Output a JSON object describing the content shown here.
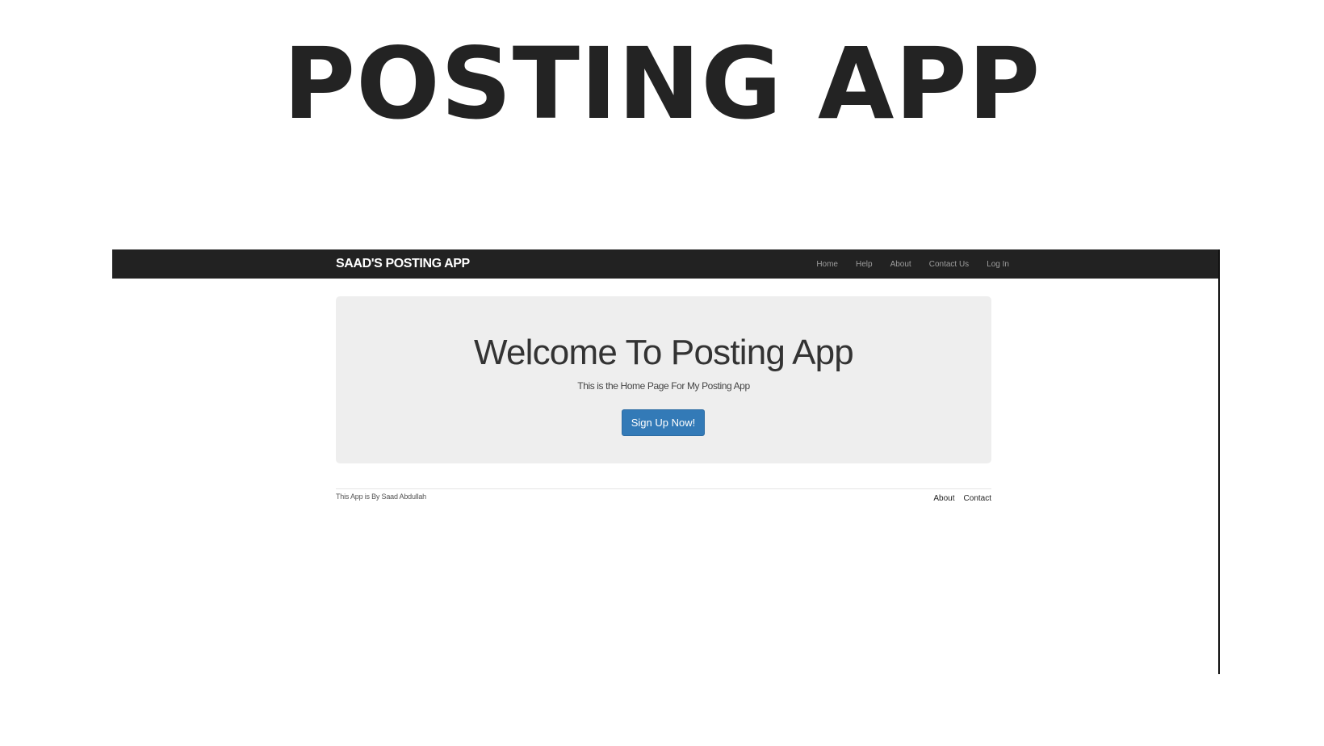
{
  "hero": {
    "title": "POSTING APP"
  },
  "app": {
    "navbar": {
      "brand": "SAAD'S POSTING APP",
      "links": [
        "Home",
        "Help",
        "About",
        "Contact Us",
        "Log In"
      ]
    },
    "jumbotron": {
      "heading": "Welcome To Posting App",
      "subtitle": "This is the Home Page For My Posting App",
      "button_label": "Sign Up Now!"
    },
    "footer": {
      "credit": "This App is By Saad Abdullah",
      "links": [
        "About",
        "Contact"
      ]
    }
  },
  "colors": {
    "navbar_bg": "#222222",
    "jumbotron_bg": "#eeeeee",
    "primary_button": "#337ab7",
    "title_text": "#232323"
  }
}
